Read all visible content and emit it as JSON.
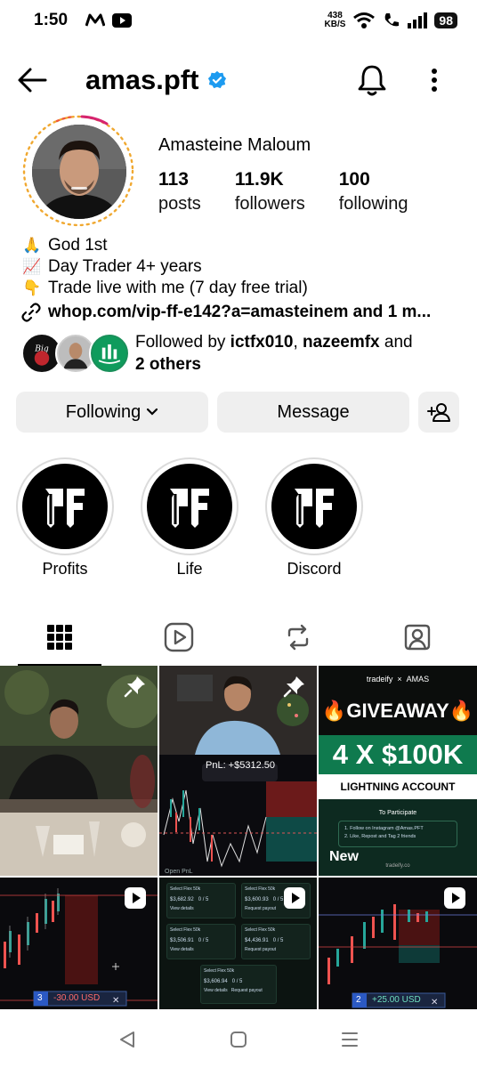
{
  "status_bar": {
    "time": "1:50",
    "left_icons": [
      "m-logo-icon",
      "youtube-icon"
    ],
    "speed_value": "438",
    "speed_unit": "KB/S",
    "battery": "98"
  },
  "header": {
    "username": "amas.pft",
    "verified": true,
    "icons": [
      "back-arrow-icon",
      "bell-icon",
      "more-vertical-icon"
    ]
  },
  "profile": {
    "full_name": "Amasteine Maloum",
    "stats": [
      {
        "value": "113",
        "label": "posts"
      },
      {
        "value": "11.9K",
        "label": "followers"
      },
      {
        "value": "100",
        "label": "following"
      }
    ],
    "bio": [
      {
        "emoji": "🙏",
        "text": "God 1st"
      },
      {
        "emoji": "📈",
        "text": "Day Trader 4+ years"
      },
      {
        "emoji": "👇",
        "text": "Trade live with me (7 day free trial)"
      }
    ],
    "link": "whop.com/vip-ff-e142?a=amasteinem and 1 m...",
    "followed_by_prefix": "Followed by ",
    "followed_by_user1": "ictfx010",
    "followed_by_sep": ", ",
    "followed_by_user2": "nazeemfx",
    "followed_by_and": " and",
    "followed_by_others": "2 others"
  },
  "buttons": {
    "following": "Following",
    "message": "Message"
  },
  "highlights": [
    {
      "label": "Profits"
    },
    {
      "label": "Life"
    },
    {
      "label": "Discord"
    }
  ],
  "tabs": [
    "grid-icon",
    "reels-icon",
    "reposts-icon",
    "tagged-icon"
  ],
  "posts": {
    "p2_pnl": "PnL: +$5312.50",
    "p2_open": "Open PnL",
    "p3_brand": "tradeify",
    "p3_x": "×",
    "p3_amas": "AMAS",
    "p3_giveaway": "GIVEAWAY",
    "p3_amount": "4 X $100K",
    "p3_account": "LIGHTNING ACCOUNT",
    "p3_participate": "To Participate",
    "p3_step1": "1. Follow on Instagram @Amas.PFT",
    "p3_step2": "2. Like, Repost and Tag 2 friends",
    "p3_new": "New",
    "p3_footer": "tradeify.co",
    "p4_qty": "3",
    "p4_pnl": "-30.00 USD",
    "p5_title": "Select Flex 50k",
    "p5_value1": "$3,682.92",
    "p5_value2": "$3,600.93",
    "p5_value3": "$3,506.91",
    "p5_value4": "$4,436.91",
    "p5_value5": "$3,606.94",
    "p5_ratio": "0 / 5",
    "p5_view": "View details",
    "p5_request": "Request payout",
    "p6_qty": "2",
    "p6_pnl": "+25.00 USD"
  },
  "colors": {
    "verified_blue": "#1d9bf0",
    "button_bg": "#efefef",
    "giveaway_green": "#0f7a4e"
  }
}
